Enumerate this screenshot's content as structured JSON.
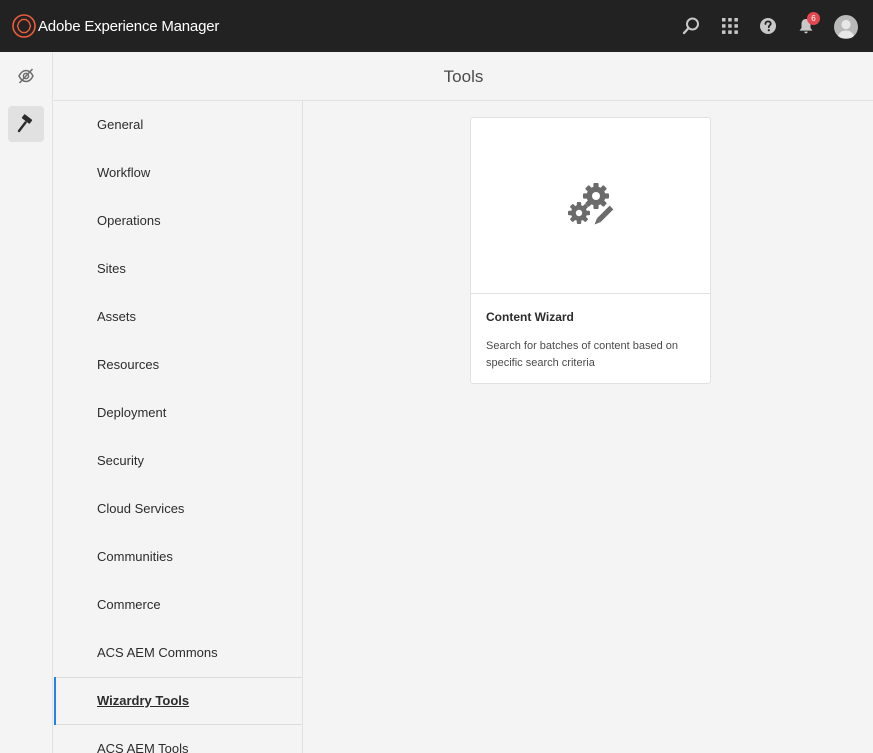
{
  "header": {
    "app_title": "Adobe Experience Manager",
    "icons": [
      "adobe-logo-icon",
      "search-icon",
      "apps-grid-icon",
      "help-icon",
      "bell-icon",
      "user-avatar"
    ],
    "notification_count": "6",
    "colors": {
      "background": "#222222",
      "badge": "#e34850",
      "logo_accent": "#eb5d3c"
    }
  },
  "rail": {
    "items": [
      {
        "icon": "navigation-icon",
        "active": false
      },
      {
        "icon": "hammer-icon",
        "active": true
      }
    ]
  },
  "page": {
    "title": "Tools"
  },
  "nav": {
    "items": [
      {
        "label": "General"
      },
      {
        "label": "Workflow"
      },
      {
        "label": "Operations"
      },
      {
        "label": "Sites"
      },
      {
        "label": "Assets"
      },
      {
        "label": "Resources"
      },
      {
        "label": "Deployment"
      },
      {
        "label": "Security"
      },
      {
        "label": "Cloud Services"
      },
      {
        "label": "Communities"
      },
      {
        "label": "Commerce"
      },
      {
        "label": "ACS AEM Commons"
      },
      {
        "label": "Wizardry Tools",
        "selected": true
      },
      {
        "label": "ACS AEM Tools"
      }
    ],
    "selected_color": "#2680eb"
  },
  "cards": [
    {
      "icon": "gears-pencil-icon",
      "title": "Content Wizard",
      "description": "Search for batches of content based on specific search criteria"
    }
  ]
}
